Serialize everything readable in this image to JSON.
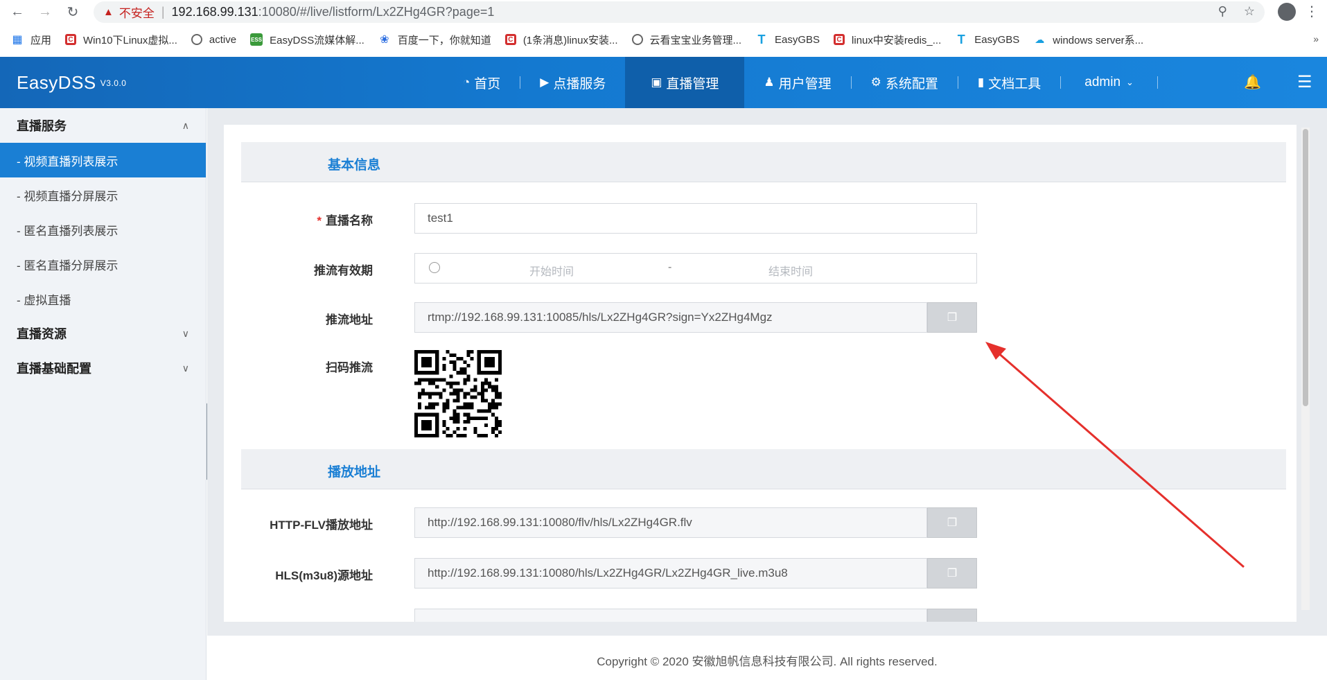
{
  "browser": {
    "insecure_label": "不安全",
    "url_host": "192.168.99.131",
    "url_path": ":10080/#/live/listform/Lx2ZHg4GR?page=1",
    "bookmarks": [
      {
        "label": "应用",
        "icon": "apps-icon"
      },
      {
        "label": "Win10下Linux虚拟...",
        "icon": "csdn-icon"
      },
      {
        "label": "active",
        "icon": "globe-icon"
      },
      {
        "label": "EasyDSS流媒体解...",
        "icon": "ess-icon"
      },
      {
        "label": "百度一下，你就知道",
        "icon": "baidu-icon"
      },
      {
        "label": "(1条消息)linux安装...",
        "icon": "csdn-icon"
      },
      {
        "label": "云看宝宝业务管理...",
        "icon": "globe-icon"
      },
      {
        "label": "EasyGBS",
        "icon": "t-icon"
      },
      {
        "label": "linux中安装redis_...",
        "icon": "csdn-icon"
      },
      {
        "label": "EasyGBS",
        "icon": "t-icon"
      },
      {
        "label": "windows server系...",
        "icon": "cloud-icon"
      }
    ]
  },
  "header": {
    "logo": "EasyDSS",
    "version": "V3.0.0",
    "nav": [
      {
        "label": "首页",
        "icon": "dashboard-icon"
      },
      {
        "label": "点播服务",
        "icon": "video-icon"
      },
      {
        "label": "直播管理",
        "icon": "live-tv-icon"
      },
      {
        "label": "用户管理",
        "icon": "user-icon"
      },
      {
        "label": "系统配置",
        "icon": "gear-icon"
      },
      {
        "label": "文档工具",
        "icon": "document-icon"
      }
    ],
    "user": "admin"
  },
  "sidebar": {
    "groups": [
      {
        "label": "直播服务",
        "expanded": true,
        "items": [
          "- 视频直播列表展示",
          "- 视频直播分屏展示",
          "- 匿名直播列表展示",
          "- 匿名直播分屏展示",
          "- 虚拟直播"
        ]
      },
      {
        "label": "直播资源",
        "expanded": false
      },
      {
        "label": "直播基础配置",
        "expanded": false
      }
    ],
    "active_item": "- 视频直播列表展示"
  },
  "form": {
    "basic_section": "基本信息",
    "name_label": "直播名称",
    "name_value": "test1",
    "validity_label": "推流有效期",
    "start_placeholder": "开始时间",
    "range_separator": "-",
    "end_placeholder": "结束时间",
    "push_label": "推流地址",
    "push_url": "rtmp://192.168.99.131:10085/hls/Lx2ZHg4GR?sign=Yx2ZHg4Mgz",
    "qr_label": "扫码推流",
    "play_section": "播放地址",
    "flv_label": "HTTP-FLV播放地址",
    "flv_url": "http://192.168.99.131:10080/flv/hls/Lx2ZHg4GR.flv",
    "hls_label": "HLS(m3u8)源地址",
    "hls_url": "http://192.168.99.131:10080/hls/Lx2ZHg4GR/Lx2ZHg4GR_live.m3u8"
  },
  "footer": {
    "copyright": "Copyright © 2020 安徽旭帆信息科技有限公司. All rights reserved."
  },
  "colors": {
    "primary": "#1a7fd4",
    "header_bg": "#1479d0",
    "annotation_arrow": "#e5302c"
  }
}
